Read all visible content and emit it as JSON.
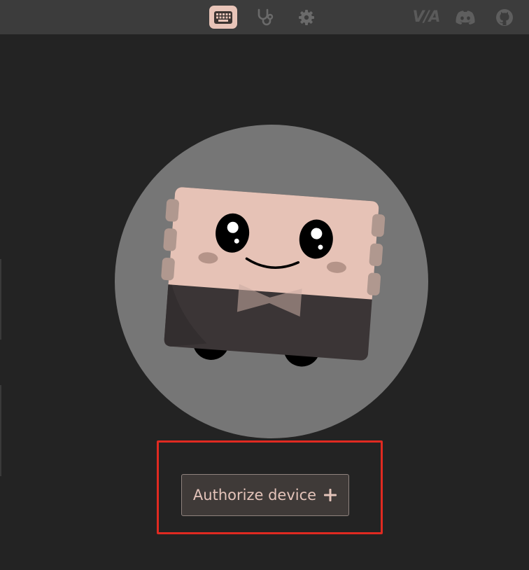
{
  "topbar": {
    "nav": [
      {
        "name": "keyboard-icon",
        "active": true
      },
      {
        "name": "stethoscope-icon",
        "active": false
      },
      {
        "name": "gear-icon",
        "active": false
      }
    ],
    "via_logo_text": "V/A",
    "external": [
      "discord-icon",
      "github-icon"
    ]
  },
  "main": {
    "illustration": "keyboard-mascot",
    "authorize_button_label": "Authorize device"
  },
  "annotation": {
    "highlight_color": "#e02a21"
  },
  "colors": {
    "accent": "#e8c4b8",
    "background": "#232323",
    "topbar": "#3c3c3c",
    "button_text": "#e4c4ba"
  }
}
